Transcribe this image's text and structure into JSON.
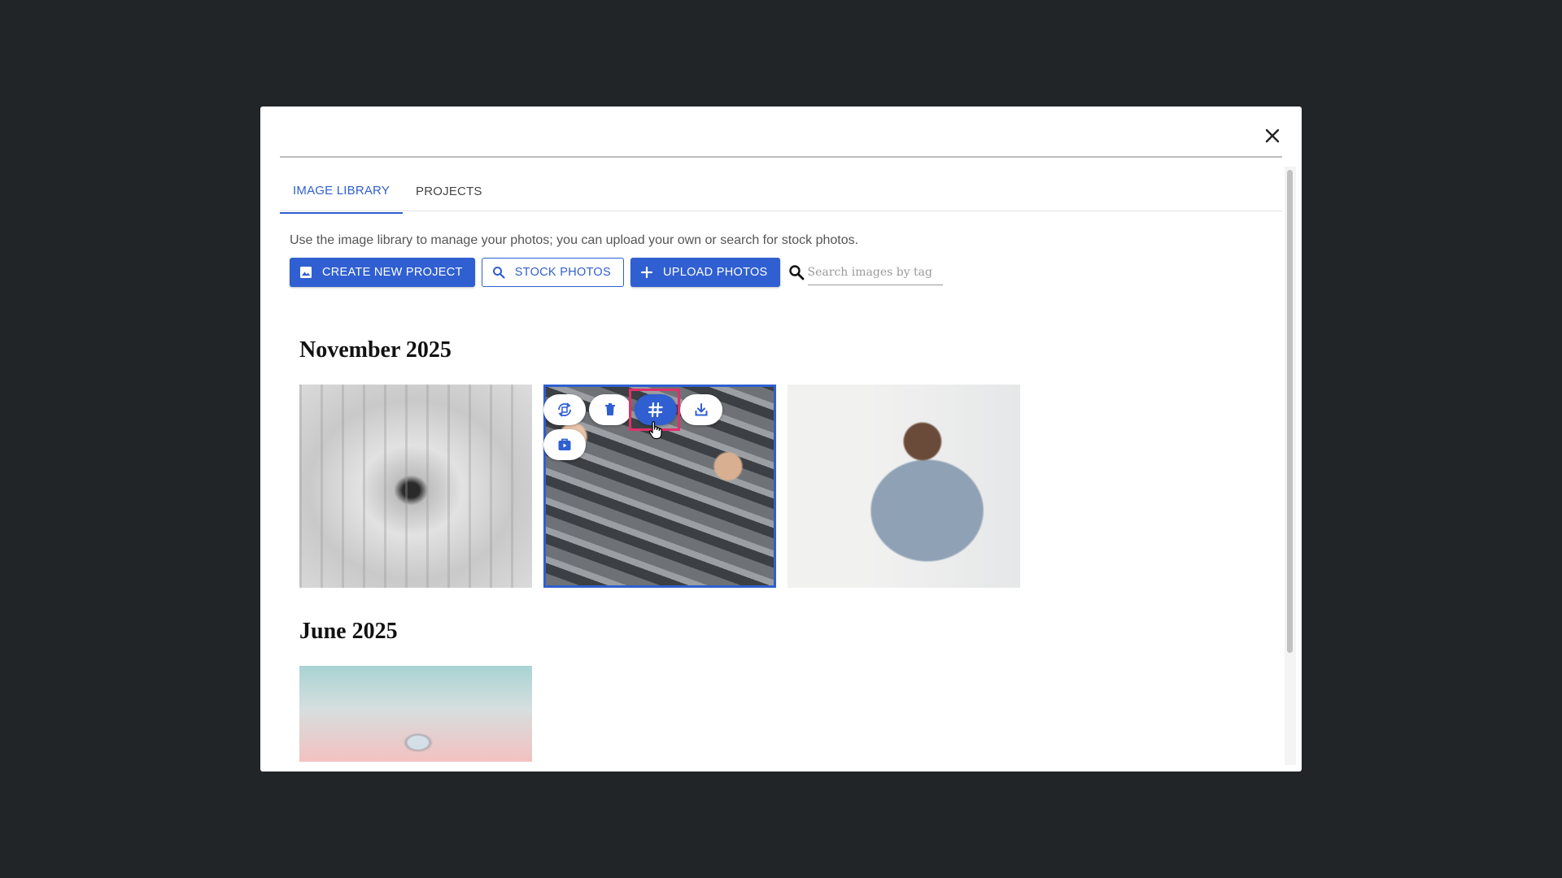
{
  "tabs": [
    {
      "label": "IMAGE LIBRARY",
      "active": true
    },
    {
      "label": "PROJECTS",
      "active": false
    }
  ],
  "description": "Use the image library to manage your photos; you can upload your own or search for stock photos.",
  "toolbar": {
    "create_project_label": "CREATE NEW PROJECT",
    "stock_photos_label": "STOCK PHOTOS",
    "upload_photos_label": "UPLOAD PHOTOS",
    "search_placeholder": "Search images by tag"
  },
  "sections": [
    {
      "title": "November 2025",
      "image_count": 3
    },
    {
      "title": "June 2025",
      "image_count": 1
    }
  ],
  "colors": {
    "accent": "#2f5fd0",
    "overlay_background": "#222528",
    "focus_highlight": "#e0306a"
  },
  "image_actions": [
    "rotate-icon",
    "trash-icon",
    "hashtag-icon",
    "download-icon",
    "add-to-project-icon"
  ]
}
